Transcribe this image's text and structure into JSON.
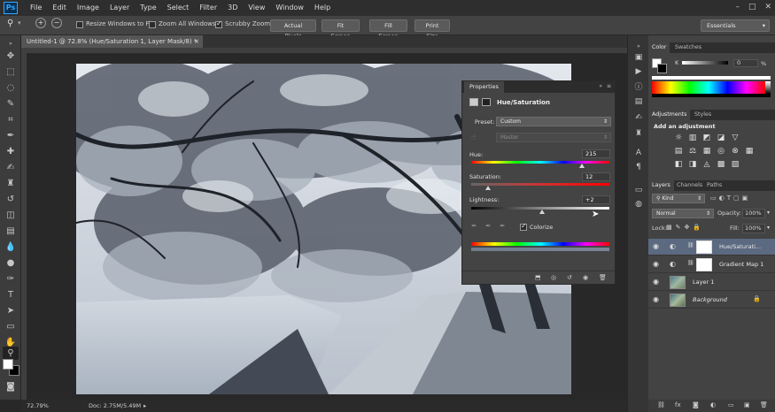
{
  "app": {
    "logo": "Ps"
  },
  "menu": [
    "File",
    "Edit",
    "Image",
    "Layer",
    "Type",
    "Select",
    "Filter",
    "3D",
    "View",
    "Window",
    "Help"
  ],
  "window_controls": [
    "–",
    "□",
    "✕"
  ],
  "options": {
    "resize_label": "Resize Windows to Fit",
    "resize_checked": false,
    "zoom_all_label": "Zoom All Windows",
    "zoom_all_checked": false,
    "scrubby_label": "Scrubby Zoom",
    "scrubby_checked": true,
    "btn_actual": "Actual Pixels",
    "btn_fit": "Fit Screen",
    "btn_fill": "Fill Screen",
    "btn_print": "Print Size",
    "workspace": "Essentials"
  },
  "document": {
    "tab_title": "Untitled-1 @ 72.8% (Hue/Saturation 1, Layer Mask/8) *",
    "close": "×",
    "zoom": "72.79%",
    "doc_info": "Doc: 2.75M/5.49M"
  },
  "properties": {
    "tab": "Properties",
    "title": "Hue/Saturation",
    "preset_label": "Preset:",
    "preset_value": "Custom",
    "channel_value": "Master",
    "hue_label": "Hue:",
    "hue_value": "215",
    "saturation_label": "Saturation:",
    "saturation_value": "12",
    "lightness_label": "Lightness:",
    "lightness_value": "+2",
    "colorize_label": "Colorize",
    "colorize_checked": true,
    "hue_level": 0.8,
    "saturation_level": 0.12,
    "lightness_level": 0.51
  },
  "color_panel": {
    "tabs": [
      "Color",
      "Swatches"
    ],
    "channel": "K",
    "value": "0",
    "unit": "%"
  },
  "adjustments_panel": {
    "tabs": [
      "Adjustments",
      "Styles"
    ],
    "heading": "Add an adjustment",
    "row1": [
      "☼",
      "▥",
      "◩",
      "◪",
      "▽"
    ],
    "row2": [
      "▤",
      "⚖",
      "▦",
      "◎",
      "⊗",
      "▦"
    ],
    "row3": [
      "◧",
      "◨",
      "◬",
      "▩",
      "▨"
    ]
  },
  "layers_panel": {
    "tabs": [
      "Layers",
      "Channels",
      "Paths"
    ],
    "kind": "Kind",
    "blend_mode": "Normal",
    "opacity_label": "Opacity:",
    "opacity_value": "100%",
    "lock_label": "Lock:",
    "fill_label": "Fill:",
    "fill_value": "100%",
    "layers": [
      {
        "name": "Hue/Saturati...",
        "selected": true
      },
      {
        "name": "Gradient Map 1",
        "selected": false
      },
      {
        "name": "Layer 1",
        "selected": false
      },
      {
        "name": "Background",
        "selected": false
      }
    ]
  },
  "colors": {
    "accent": "#31a8ff",
    "selected_layer": "#5b6a80"
  }
}
